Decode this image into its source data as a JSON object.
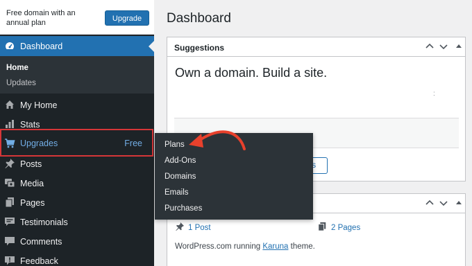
{
  "promo": {
    "text": "Free domain with an annual plan",
    "button": "Upgrade"
  },
  "sidebar": {
    "dashboard": "Dashboard",
    "submenu": {
      "home": "Home",
      "updates": "Updates"
    },
    "items": [
      {
        "label": "My Home",
        "icon": "home-icon"
      },
      {
        "label": "Stats",
        "icon": "stats-icon"
      },
      {
        "label": "Upgrades",
        "icon": "cart-icon",
        "badge": "Free"
      },
      {
        "label": "Posts",
        "icon": "pin-icon"
      },
      {
        "label": "Media",
        "icon": "media-icon"
      },
      {
        "label": "Pages",
        "icon": "pages-icon"
      },
      {
        "label": "Testimonials",
        "icon": "testimonial-icon"
      },
      {
        "label": "Comments",
        "icon": "comment-icon"
      },
      {
        "label": "Feedback",
        "icon": "feedback-icon"
      }
    ]
  },
  "flyout": {
    "items": [
      "Plans",
      "Add-Ons",
      "Domains",
      "Emails",
      "Purchases"
    ]
  },
  "main": {
    "title": "Dashboard",
    "suggestions": {
      "title": "Suggestions",
      "headline": "Own a domain. Build a site.",
      "dots": ":",
      "button_fragment": "ns"
    },
    "glance": {
      "posts": "1 Post",
      "pages": "2 Pages",
      "footer_prefix": "WordPress.com running ",
      "theme": "Karuna",
      "footer_suffix": " theme."
    }
  },
  "colors": {
    "accent": "#2271b1",
    "sidebar": "#1d2327",
    "highlight": "#d63638"
  }
}
